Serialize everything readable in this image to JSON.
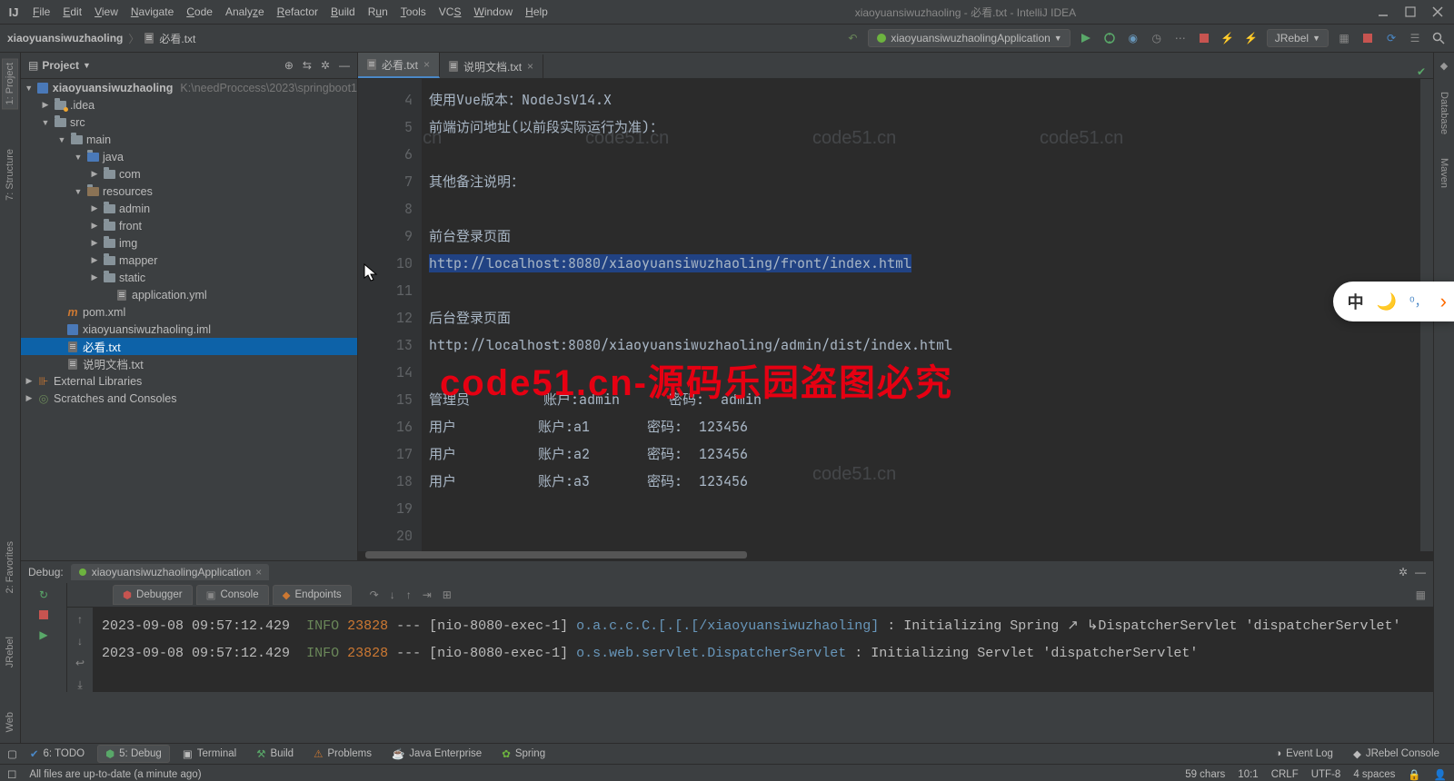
{
  "window": {
    "title": "xiaoyuansiwuzhaoling - 必看.txt - IntelliJ IDEA"
  },
  "menubar": [
    "File",
    "Edit",
    "View",
    "Navigate",
    "Code",
    "Analyze",
    "Refactor",
    "Build",
    "Run",
    "Tools",
    "VCS",
    "Window",
    "Help"
  ],
  "breadcrumb": {
    "root": "xiaoyuansiwuzhaoling",
    "file": "必看.txt"
  },
  "run_config": "xiaoyuansiwuzhaolingApplication",
  "jrebel_label": "JRebel",
  "left_tabs": {
    "project": "1: Project",
    "structure": "7: Structure",
    "favorites": "2: Favorites",
    "jrebel": "JRebel",
    "web": "Web"
  },
  "right_tabs": {
    "database": "Database",
    "maven": "Maven"
  },
  "project_panel": {
    "title": "Project",
    "root": {
      "name": "xiaoyuansiwuzhaoling",
      "path": "K:\\needProccess\\2023\\springboot1"
    },
    "nodes": {
      "idea": ".idea",
      "src": "src",
      "main": "main",
      "java": "java",
      "com": "com",
      "resources": "resources",
      "admin": "admin",
      "front": "front",
      "img": "img",
      "mapper": "mapper",
      "static": "static",
      "appyml": "application.yml",
      "pom": "pom.xml",
      "iml": "xiaoyuansiwuzhaoling.iml",
      "f1": "必看.txt",
      "f2": "说明文档.txt",
      "ext": "External Libraries",
      "scratch": "Scratches and Consoles"
    }
  },
  "editor_tabs": [
    {
      "label": "必看.txt",
      "active": true
    },
    {
      "label": "说明文档.txt",
      "active": false
    }
  ],
  "editor": {
    "gutter_start": 4,
    "gutter_end": 20,
    "lines": {
      "l4": "使用Vue版本：NodeJsV14.X",
      "l5": "前端访问地址(以前段实际运行为准)：",
      "l6": "",
      "l7": "其他备注说明：",
      "l8": "",
      "l9": "前台登录页面",
      "l10": "http://localhost:8080/xiaoyuansiwuzhaoling/front/index.html",
      "l11": "",
      "l12": "后台登录页面",
      "l13": "http://localhost:8080/xiaoyuansiwuzhaoling/admin/dist/index.html",
      "l14": "",
      "l15": "管理员         账户:admin      密码:  admin",
      "l16": "用户          账户:a1       密码:  123456",
      "l17": "用户          账户:a2       密码:  123456",
      "l18": "用户          账户:a3       密码:  123456",
      "l19": "",
      "l20": ""
    }
  },
  "debug": {
    "title": "Debug:",
    "config": "xiaoyuansiwuzhaolingApplication",
    "tabs": {
      "debugger": "Debugger",
      "console": "Console",
      "endpoints": "Endpoints"
    },
    "log": {
      "ts": "2023-09-08 09:57:12.429",
      "level": "INFO",
      "pid": "23828",
      "thr": "--- [nio-8080-exec-1]",
      "cls1": "o.a.c.c.C.[.[.[/xiaoyuansiwuzhaoling]",
      "msg1": ": Initializing Spring",
      "cls2": "o.s.web.servlet.DispatcherServlet",
      "msg2": ": Initializing Servlet",
      "wrap1": "DispatcherServlet 'dispatcherServlet'",
      "wrap2": "'dispatcherServlet'"
    }
  },
  "bottom_tools": {
    "todo": "6: TODO",
    "debug": "5: Debug",
    "terminal": "Terminal",
    "build": "Build",
    "problems": "Problems",
    "javaee": "Java Enterprise",
    "spring": "Spring",
    "eventlog": "Event Log",
    "jrebelc": "JRebel Console"
  },
  "statusbar": {
    "msg": "All files are up-to-date (a minute ago)",
    "chars": "59 chars",
    "pos": "10:1",
    "eol": "CRLF",
    "enc": "UTF-8",
    "indent": "4 spaces"
  },
  "watermark": "code51.cn-源码乐园盗图必究",
  "wm_light": "code51.cn",
  "float": {
    "a": "中"
  }
}
